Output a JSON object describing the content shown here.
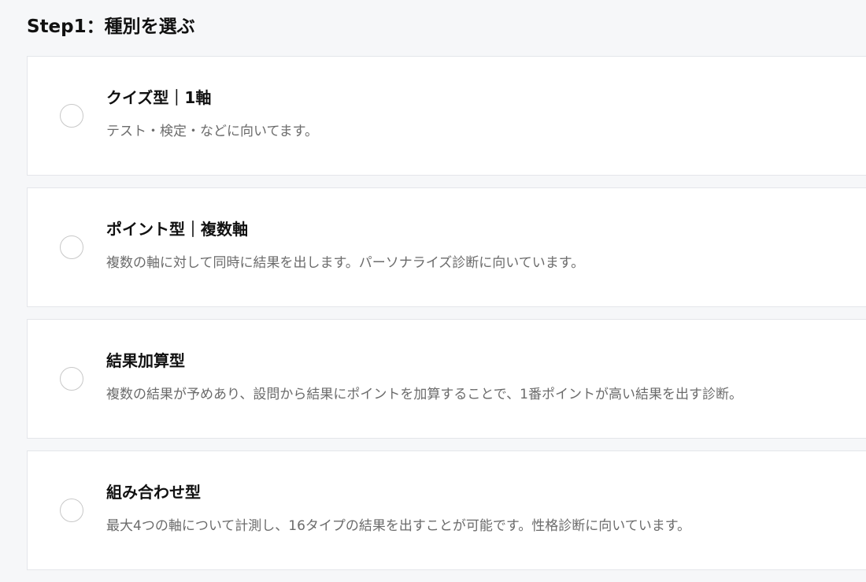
{
  "page": {
    "step_title": "Step1：種別を選ぶ"
  },
  "options": [
    {
      "title": "クイズ型｜1軸",
      "description": "テスト・検定・などに向いてます。",
      "selected": false
    },
    {
      "title": "ポイント型｜複数軸",
      "description": "複数の軸に対して同時に結果を出します。パーソナライズ診断に向いています。",
      "selected": false
    },
    {
      "title": "結果加算型",
      "description": "複数の結果が予めあり、設問から結果にポイントを加算することで、1番ポイントが高い結果を出す診断。",
      "selected": false
    },
    {
      "title": "組み合わせ型",
      "description": "最大4つの軸について計測し、16タイプの結果を出すことが可能です。性格診断に向いています。",
      "selected": false
    }
  ]
}
